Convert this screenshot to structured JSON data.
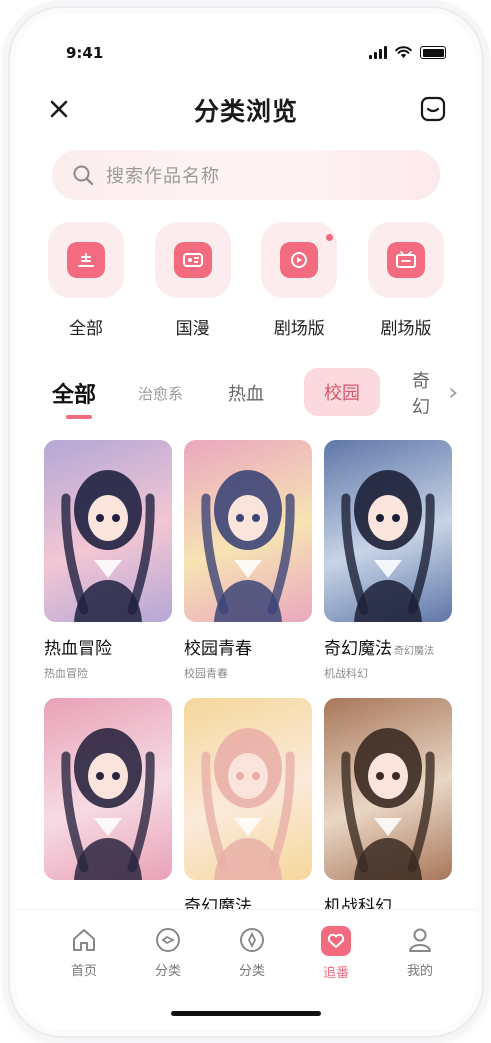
{
  "status_bar": {
    "time": "9:41"
  },
  "header": {
    "title": "分类浏览"
  },
  "search": {
    "placeholder": "搜索作品名称"
  },
  "categories": [
    {
      "label": "全部",
      "icon": "all-category-icon"
    },
    {
      "label": "国漫",
      "icon": "comic-category-icon"
    },
    {
      "label": "剧场版",
      "icon": "theater-category-icon"
    },
    {
      "label": "剧场版",
      "icon": "movie-category-icon"
    }
  ],
  "tabs": [
    {
      "label": "全部",
      "active": true
    },
    {
      "label": "治愈系",
      "active": false
    },
    {
      "label": "热血",
      "active": false
    },
    {
      "label": "校园",
      "active": false,
      "highlighted": true
    },
    {
      "label": "奇幻",
      "active": false
    }
  ],
  "cards": [
    {
      "title": "热血冒险",
      "title_suffix": "",
      "subtitle": "热血冒险",
      "palette": [
        "#b4a7d6",
        "#f3c6d3",
        "#1f2140"
      ]
    },
    {
      "title": "校园青春",
      "title_suffix": "",
      "subtitle": "校园青春",
      "palette": [
        "#eaa7bf",
        "#f6e3b3",
        "#3d4577"
      ]
    },
    {
      "title": "奇幻魔法",
      "title_suffix": "奇幻魔法",
      "subtitle": "机战科幻",
      "palette": [
        "#5f77a8",
        "#c7d3e6",
        "#1c2036"
      ]
    },
    {
      "title": "",
      "title_suffix": "",
      "subtitle": "",
      "palette": [
        "#e9a1b7",
        "#f6dbe3",
        "#2b2640"
      ]
    },
    {
      "title": "奇幻魔法",
      "title_suffix": "",
      "subtitle": "",
      "palette": [
        "#f5d79a",
        "#fbeadb",
        "#e9b0a8"
      ]
    },
    {
      "title": "机战科幻",
      "title_suffix": "",
      "subtitle": "",
      "palette": [
        "#a8775a",
        "#e9d6c4",
        "#3b2a22"
      ]
    }
  ],
  "tab_bar": [
    {
      "label": "首页",
      "icon": "home-icon",
      "active": false
    },
    {
      "label": "分类",
      "icon": "category-icon",
      "active": false
    },
    {
      "label": "分类",
      "icon": "compass-icon",
      "active": false
    },
    {
      "label": "追番",
      "icon": "heart-icon",
      "active": true
    },
    {
      "label": "我的",
      "icon": "profile-icon",
      "active": false
    }
  ],
  "colors": {
    "accent": "#f26b7f",
    "accent_light": "#fdecee",
    "text": "#111111"
  }
}
